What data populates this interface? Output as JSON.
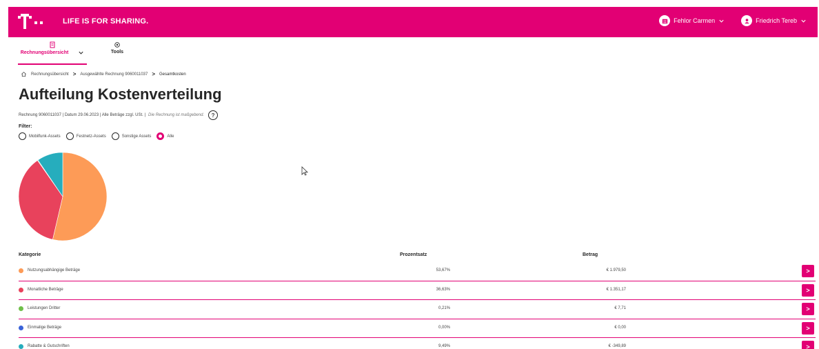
{
  "header": {
    "tagline": "LIFE IS FOR SHARING.",
    "account_name": "Fehlor Carmen",
    "user_name": "Friedrich Tereb",
    "colors": {
      "brand": "#e20074"
    }
  },
  "subnav": {
    "active_label": "Rechnungsübersicht",
    "tools_label": "Tools"
  },
  "breadcrumb": {
    "items": [
      "Rechnungsübersicht",
      "Ausgewählte Rechnung 9060011037",
      "Gesamtkosten"
    ],
    "separator": ">"
  },
  "page": {
    "title": "Aufteilung Kostenverteilung",
    "meta": "Rechnung 9060011037 | Datum 29.06.2023 | Alle Beträge zzgl. USt. |",
    "meta_note": "Die Rechnung ist maßgebend.",
    "help": "?"
  },
  "filter": {
    "label": "Filter:",
    "options": [
      "Mobilfunk-Assets",
      "Festnetz-Assets",
      "Sonstige Assets",
      "Alle"
    ],
    "selected": "Alle"
  },
  "chart_data": {
    "type": "pie",
    "categories": [
      "Nutzungsabhängige Beträge",
      "Monatliche Beträge",
      "Leistungen Dritter",
      "Einmalige Beträge",
      "Rabatte & Gutschriften"
    ],
    "values": [
      53.67,
      36.63,
      0.21,
      0.0,
      9.49
    ],
    "colors": [
      "#fd9b57",
      "#e8425c",
      "#6fbf4a",
      "#3a63d8",
      "#26adbd"
    ]
  },
  "table": {
    "headers": {
      "category": "Kategorie",
      "percent": "Prozentsatz",
      "amount": "Betrag"
    },
    "rows": [
      {
        "category": "Nutzungsabhängige Beträge",
        "percent": "53,67%",
        "amount": "€ 1.979,50",
        "color": "#fd9b57"
      },
      {
        "category": "Monatliche Beträge",
        "percent": "36,63%",
        "amount": "€ 1.351,17",
        "color": "#e8425c"
      },
      {
        "category": "Leistungen Dritter",
        "percent": "0,21%",
        "amount": "€ 7,71",
        "color": "#6fbf4a"
      },
      {
        "category": "Einmalige Beträge",
        "percent": "0,00%",
        "amount": "€ 0,00",
        "color": "#3a63d8"
      },
      {
        "category": "Rabatte & Gutschriften",
        "percent": "9,49%",
        "amount": "€ -349,89",
        "color": "#26adbd"
      }
    ],
    "row_action": ">"
  }
}
